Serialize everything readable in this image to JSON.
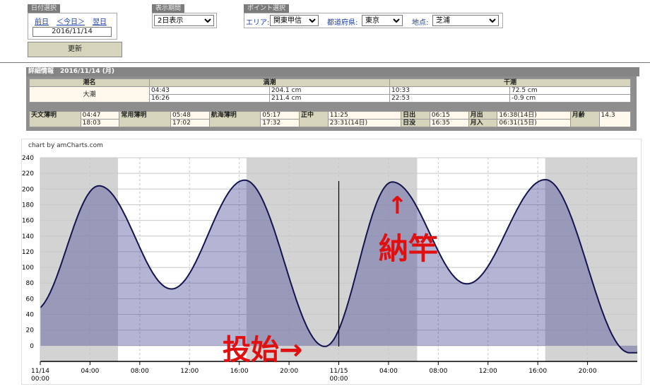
{
  "date_panel": {
    "title": "日付選択",
    "prev": "前日",
    "today": "＜今日＞",
    "next": "翌日",
    "value": "2016/11/14"
  },
  "period_panel": {
    "title": "表示期間",
    "value": "2日表示"
  },
  "point_panel": {
    "title": "ポイント選択",
    "area_label": "エリア:",
    "area_value": "関東甲信",
    "pref_label": "都道府県:",
    "pref_value": "東京",
    "place_label": "地点:",
    "place_value": "芝浦"
  },
  "update_button": "更新",
  "detail": {
    "title": "詳細情報　2016/11/14 (月)",
    "tide_header": "潮名",
    "high_header": "満潮",
    "low_header": "干潮",
    "tide_name": "大潮",
    "high": [
      {
        "time": "04:43",
        "level": "204.1 cm"
      },
      {
        "time": "16:26",
        "level": "211.4 cm"
      }
    ],
    "low": [
      {
        "time": "10:33",
        "level": "72.5 cm"
      },
      {
        "time": "22:53",
        "level": "-0.9 cm"
      }
    ],
    "astro": {
      "astro_twilight_label": "天文薄明",
      "astro_twilight": [
        "04:47",
        "18:03"
      ],
      "civil_twilight_label": "常用薄明",
      "civil_twilight": [
        "05:48",
        "17:02"
      ],
      "nautical_twilight_label": "航海薄明",
      "nautical_twilight": [
        "05:17",
        "17:32"
      ],
      "meridian_label": "正中",
      "meridian": [
        "11:25",
        "23:31(14日)"
      ],
      "sunrise_label": "日出",
      "sunset_label": "日没",
      "sunrise": "06:15",
      "sunset": "16:35",
      "moonrise_label": "月出",
      "moonset_label": "月入",
      "moonrise": "16:38(14日)",
      "moonset": "06:31(15日)",
      "moon_age_label": "月齢",
      "moon_age": "14.3"
    }
  },
  "chart_credit": "chart by amCharts.com",
  "annotations": {
    "start": "投始→",
    "end": "納竿",
    "end_arrow": "↑"
  },
  "chart_data": {
    "type": "area",
    "x_unit": "hours since 2016/11/14 00:00",
    "ylim": [
      -20,
      240
    ],
    "y_ticks": [
      0,
      20,
      40,
      60,
      80,
      100,
      120,
      140,
      160,
      180,
      200,
      220,
      240
    ],
    "x_ticks": [
      {
        "h": 0,
        "label": "11/14",
        "label2": "00:00"
      },
      {
        "h": 4,
        "label": "04:00"
      },
      {
        "h": 8,
        "label": "08:00"
      },
      {
        "h": 12,
        "label": "12:00"
      },
      {
        "h": 16,
        "label": "16:00"
      },
      {
        "h": 20,
        "label": "20:00"
      },
      {
        "h": 24,
        "label": "11/15",
        "label2": "00:00"
      },
      {
        "h": 28,
        "label": "04:00"
      },
      {
        "h": 32,
        "label": "08:00"
      },
      {
        "h": 36,
        "label": "12:00"
      },
      {
        "h": 40,
        "label": "16:00"
      },
      {
        "h": 44,
        "label": "20:00"
      }
    ],
    "extrema": [
      {
        "h": -0.5,
        "v": 45
      },
      {
        "h": 4.72,
        "v": 204.1
      },
      {
        "h": 10.55,
        "v": 72.5
      },
      {
        "h": 16.43,
        "v": 211.4
      },
      {
        "h": 22.88,
        "v": -0.9
      },
      {
        "h": 28.3,
        "v": 209
      },
      {
        "h": 34.3,
        "v": 79
      },
      {
        "h": 40.6,
        "v": 212
      },
      {
        "h": 47.4,
        "v": -9
      }
    ],
    "night_bands": [
      [
        0,
        6.25
      ],
      [
        16.58,
        30.3
      ],
      [
        40.6,
        48
      ]
    ],
    "marker_hour": 24
  }
}
